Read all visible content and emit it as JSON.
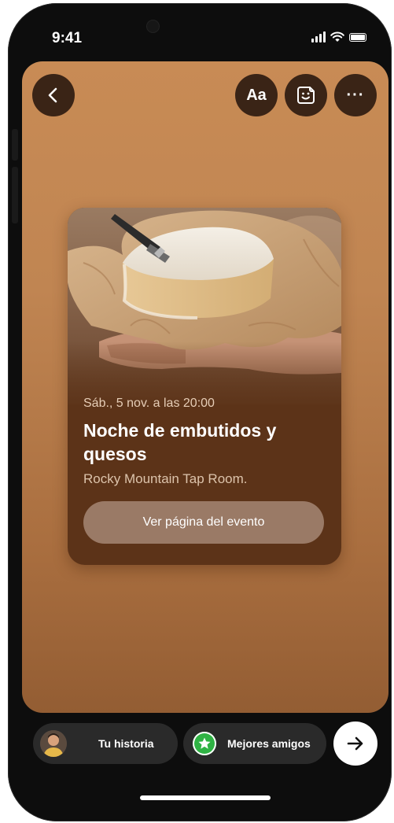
{
  "status_bar": {
    "time": "9:41"
  },
  "toolbar": {
    "back_icon": "chevron-left-icon",
    "text_label": "Aa",
    "sticker_icon": "sticker-icon",
    "more_label": "···"
  },
  "event_card": {
    "date": "Sáb., 5 nov. a las 20:00",
    "title": "Noche de embutidos y quesos",
    "location": "Rocky Mountain Tap Room.",
    "cta_label": "Ver página del evento"
  },
  "share_bar": {
    "story_label": "Tu historia",
    "close_friends_label": "Mejores amigos",
    "next_icon": "arrow-right-icon"
  },
  "colors": {
    "background_top": "#c88b55",
    "background_bottom": "#935d33",
    "card": "#5c3318",
    "cta": "#9a7a66",
    "close_friends_green": "#2fb344"
  }
}
